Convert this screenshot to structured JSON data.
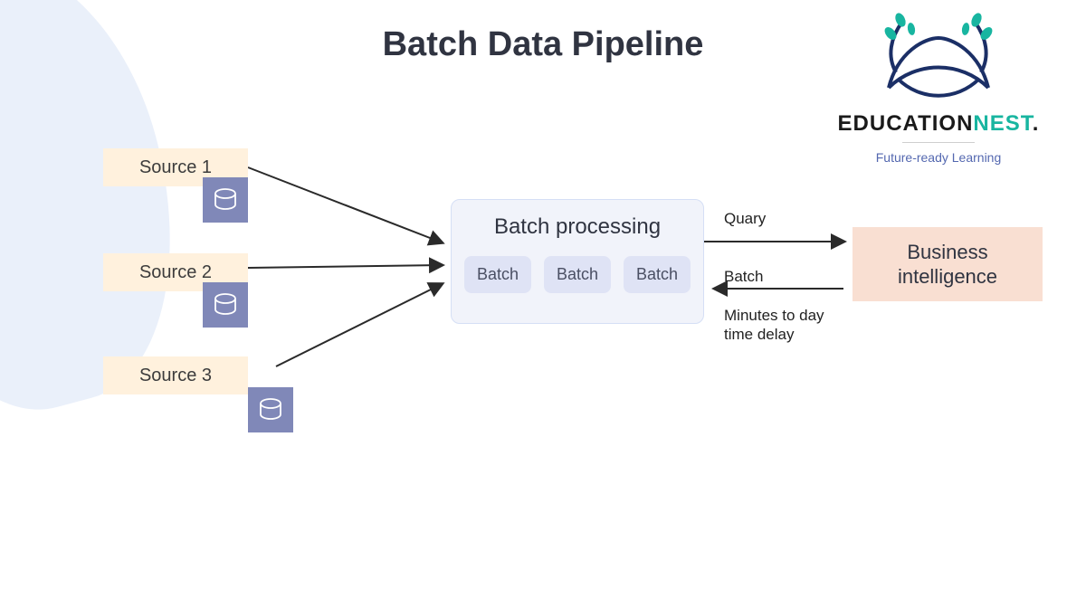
{
  "title": "Batch Data Pipeline",
  "logo": {
    "line1": "EDUCATION",
    "line2": "NEST",
    "dot": ".",
    "tagline": "Future-ready Learning"
  },
  "sources": [
    "Source 1",
    "Source 2",
    "Source  3"
  ],
  "processing": {
    "title": "Batch processing",
    "chips": [
      "Batch",
      "Batch",
      "Batch"
    ]
  },
  "output": "Business\nintelligence",
  "annotations": {
    "query": "Quary",
    "batch": "Batch",
    "delay": "Minutes to day\ntime delay"
  }
}
